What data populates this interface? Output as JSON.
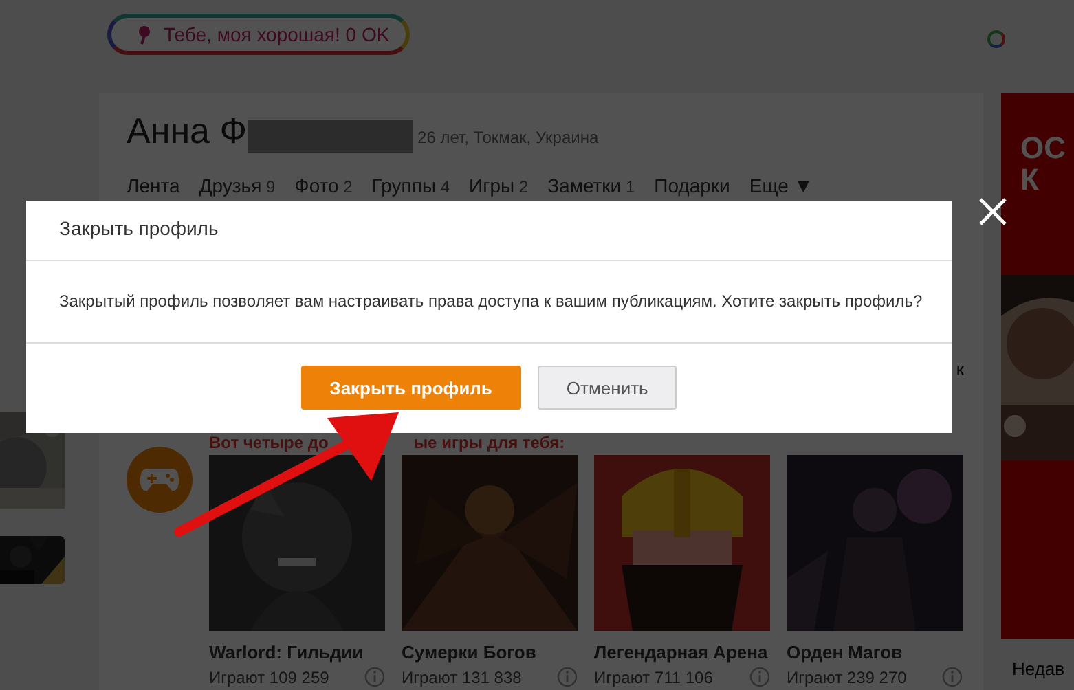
{
  "greeting": {
    "text": "Тебе, моя хорошая! 0 OK"
  },
  "profile": {
    "name": "Анна Ф",
    "details": "26 лет, Токмак, Украина"
  },
  "nav": [
    {
      "label": "Лента"
    },
    {
      "label": "Друзья",
      "count": "9"
    },
    {
      "label": "Фото",
      "count": "2"
    },
    {
      "label": "Группы",
      "count": "4"
    },
    {
      "label": "Игры",
      "count": "2"
    },
    {
      "label": "Заметки",
      "count": "1"
    },
    {
      "label": "Подарки"
    },
    {
      "label": "Еще ▼"
    }
  ],
  "partial_text": "к",
  "ad": {
    "lines": [
      "ОС",
      "К"
    ]
  },
  "side_text": "Недав",
  "games": {
    "heading_parts": [
      "Вот четыре до",
      "ые игры для тебя:"
    ],
    "items": [
      {
        "title": "Warlord: Гильдии",
        "players": "Играют 109 259"
      },
      {
        "title": "Сумерки Богов",
        "players": "Играют 131 838"
      },
      {
        "title": "Легендарная Арена",
        "players": "Играют 711 106"
      },
      {
        "title": "Орден Магов",
        "players": "Играют 239 270"
      }
    ]
  },
  "dialog": {
    "title": "Закрыть профиль",
    "message": "Закрытый профиль позволяет вам настраивать права доступа к вашим публикациям. Хотите закрыть профиль?",
    "buttons": [
      {
        "label": "Закрыть профиль",
        "kind": "primary"
      },
      {
        "label": "Отменить",
        "kind": "secondary"
      }
    ]
  }
}
